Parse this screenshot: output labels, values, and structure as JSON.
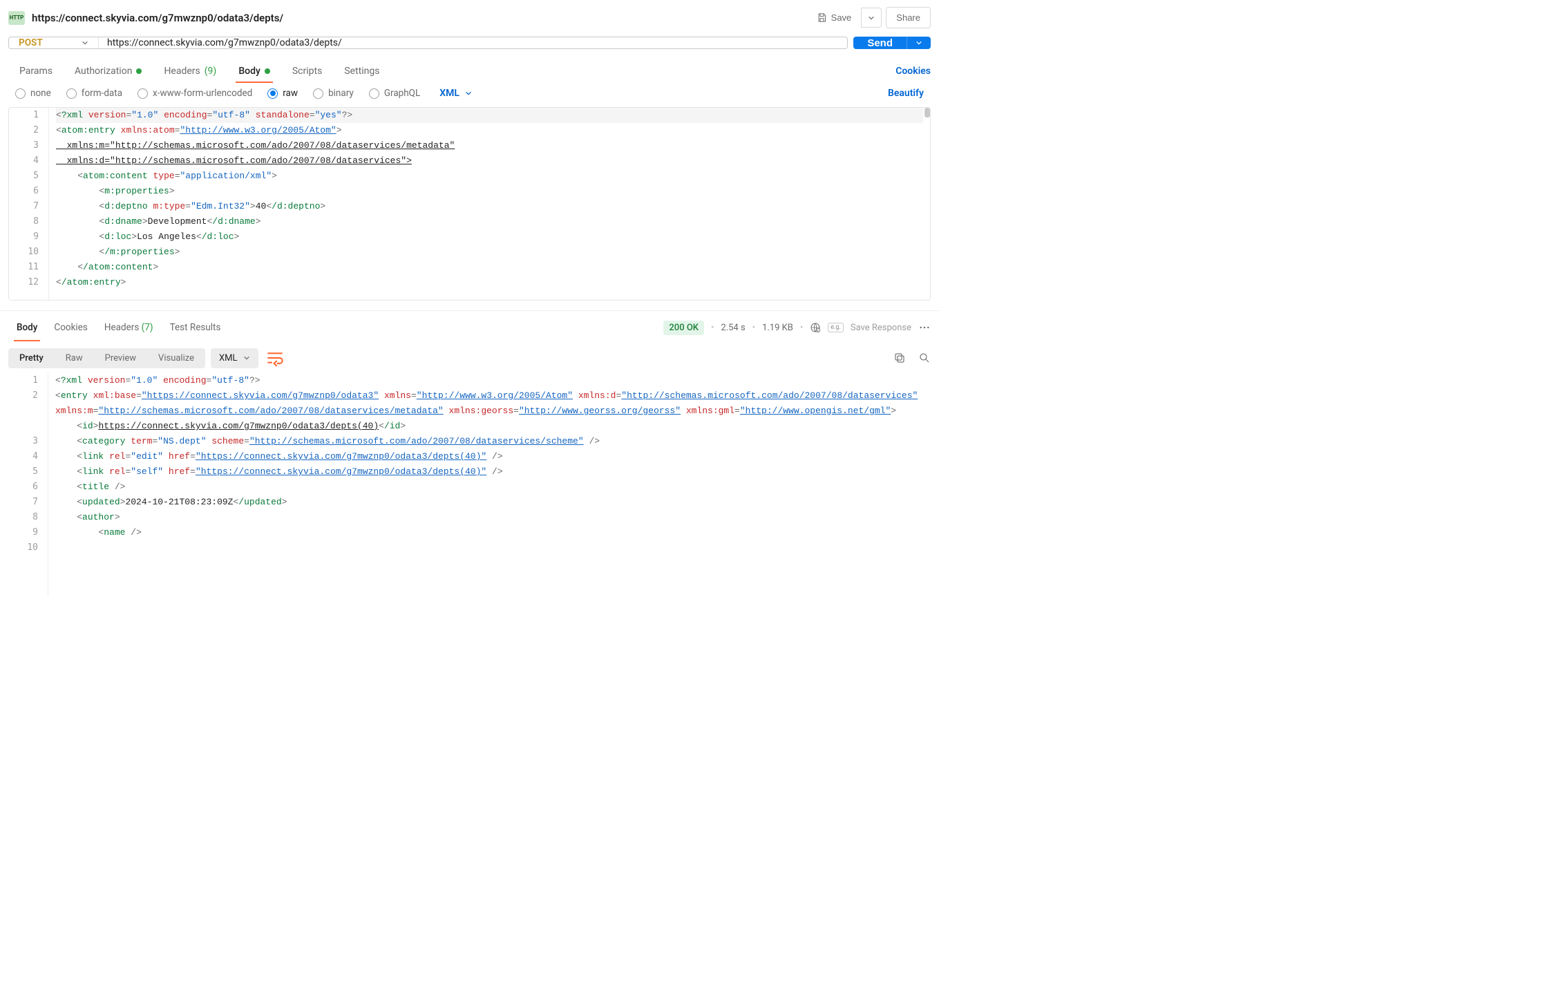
{
  "header": {
    "url_title": "https://connect.skyvia.com/g7mwznp0/odata3/depts/",
    "save_label": "Save",
    "share_label": "Share"
  },
  "request": {
    "method": "POST",
    "url": "https://connect.skyvia.com/g7mwznp0/odata3/depts/",
    "send_label": "Send",
    "tabs": {
      "params": "Params",
      "authorization": "Authorization",
      "headers": "Headers",
      "headers_count": "(9)",
      "body": "Body",
      "scripts": "Scripts",
      "settings": "Settings",
      "cookies": "Cookies"
    },
    "body_types": {
      "none": "none",
      "form_data": "form-data",
      "x_www": "x-www-form-urlencoded",
      "raw": "raw",
      "binary": "binary",
      "graphql": "GraphQL",
      "lang": "XML",
      "beautify": "Beautify"
    },
    "body_lines": [
      "<?xml version=\"1.0\" encoding=\"utf-8\" standalone=\"yes\"?>",
      "<atom:entry xmlns:atom=\"http://www.w3.org/2005/Atom\"",
      "  xmlns:m=\"http://schemas.microsoft.com/ado/2007/08/dataservices/metadata\"",
      "  xmlns:d=\"http://schemas.microsoft.com/ado/2007/08/dataservices\">",
      "    <atom:content type=\"application/xml\">",
      "        <m:properties>",
      "        <d:deptno m:type=\"Edm.Int32\">40</d:deptno>",
      "        <d:dname>Development</d:dname>",
      "        <d:loc>Los Angeles</d:loc>",
      "        </m:properties>",
      "    </atom:content>",
      "</atom:entry>"
    ]
  },
  "response": {
    "tabs": {
      "body": "Body",
      "cookies": "Cookies",
      "headers": "Headers",
      "headers_count": "(7)",
      "test_results": "Test Results"
    },
    "status": "200 OK",
    "time": "2.54 s",
    "size": "1.19 KB",
    "save_response": "Save Response",
    "view": {
      "pretty": "Pretty",
      "raw": "Raw",
      "preview": "Preview",
      "visualize": "Visualize",
      "format": "XML"
    },
    "body_lines": [
      "<?xml version=\"1.0\" encoding=\"utf-8\"?>",
      "<entry xml:base=\"https://connect.skyvia.com/g7mwznp0/odata3\" xmlns=\"http://www.w3.org/2005/Atom\" xmlns:d=\"http://schemas.microsoft.com/ado/2007/08/dataservices\" xmlns:m=\"http://schemas.microsoft.com/ado/2007/08/dataservices/metadata\" xmlns:georss=\"http://www.georss.org/georss\" xmlns:gml=\"http://www.opengis.net/gml\">",
      "    <id>https://connect.skyvia.com/g7mwznp0/odata3/depts(40)</id>",
      "    <category term=\"NS.dept\" scheme=\"http://schemas.microsoft.com/ado/2007/08/dataservices/scheme\" />",
      "    <link rel=\"edit\" href=\"https://connect.skyvia.com/g7mwznp0/odata3/depts(40)\" />",
      "    <link rel=\"self\" href=\"https://connect.skyvia.com/g7mwznp0/odata3/depts(40)\" />",
      "    <title />",
      "    <updated>2024-10-21T08:23:09Z</updated>",
      "    <author>",
      "        <name />"
    ]
  }
}
